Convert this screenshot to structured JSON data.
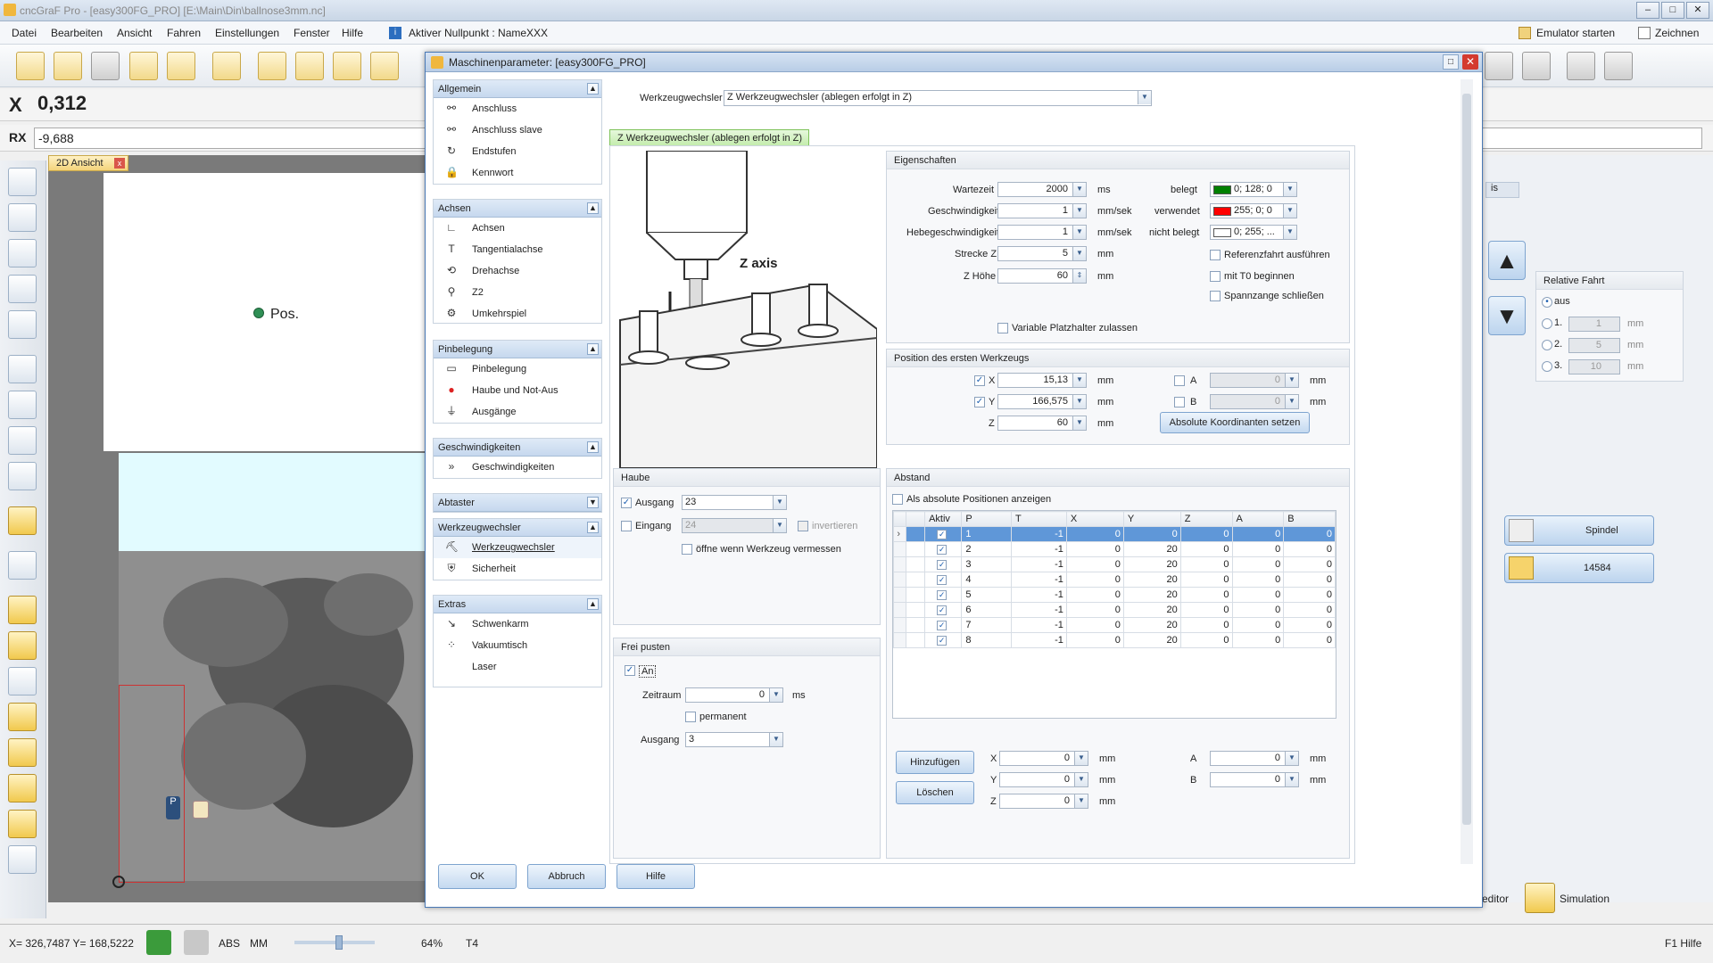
{
  "window": {
    "title": "cncGraF Pro - [easy300FG_PRO] [E:\\Main\\Din\\ballnose3mm.nc]"
  },
  "menu": [
    "Datei",
    "Bearbeiten",
    "Ansicht",
    "Fahren",
    "Einstellungen",
    "Fenster",
    "Hilfe"
  ],
  "nullpoint": "Aktiver Nullpunkt : NameXXX",
  "topright": {
    "emulator": "Emulator starten",
    "draw": "Zeichnen"
  },
  "coords": {
    "x_label": "X",
    "x_value": "0,312",
    "rx_label": "RX",
    "rx_value": "-9,688"
  },
  "view": {
    "tab": "2D Ansicht",
    "pos_label": "Pos."
  },
  "dialog": {
    "title": "Maschinenparameter: [easy300FG_PRO]",
    "changer_label": "Werkzeugwechsler",
    "changer_value": "Z Werkzeugwechsler (ablegen erfolgt in Z)",
    "tab": "Z Werkzeugwechsler (ablegen erfolgt in Z)",
    "diagram_label": "Z axis",
    "nav": [
      {
        "title": "Allgemein",
        "items": [
          "Anschluss",
          "Anschluss slave",
          "Endstufen",
          "Kennwort"
        ]
      },
      {
        "title": "Achsen",
        "items": [
          "Achsen",
          "Tangentialachse",
          "Drehachse",
          "Z2",
          "Umkehrspiel"
        ]
      },
      {
        "title": "Pinbelegung",
        "items": [
          "Pinbelegung",
          "Haube und Not-Aus",
          "Ausgänge"
        ]
      },
      {
        "title": "Geschwindigkeiten",
        "items": [
          "Geschwindigkeiten"
        ]
      },
      {
        "title": "Abtaster",
        "items": []
      },
      {
        "title": "Werkzeugwechsler",
        "items": [
          "Werkzeugwechsler",
          "Sicherheit"
        ]
      },
      {
        "title": "Extras",
        "items": [
          "Schwenkarm",
          "Vakuumtisch",
          "Laser"
        ]
      }
    ],
    "props": {
      "title": "Eigenschaften",
      "wartezeit": {
        "label": "Wartezeit",
        "value": "2000",
        "unit": "ms"
      },
      "geschw": {
        "label": "Geschwindigkeit",
        "value": "1",
        "unit": "mm/sek"
      },
      "hebe": {
        "label": "Hebegeschwindigkeit",
        "value": "1",
        "unit": "mm/sek"
      },
      "strecke": {
        "label": "Strecke Z",
        "value": "5",
        "unit": "mm"
      },
      "zhoehe": {
        "label": "Z Höhe",
        "value": "60",
        "unit": "mm"
      },
      "belegt": {
        "label": "belegt",
        "value": "0; 128; 0",
        "color": "#008000"
      },
      "verwendet": {
        "label": "verwendet",
        "value": "255; 0; 0",
        "color": "#ff0000"
      },
      "nicht": {
        "label": "nicht belegt",
        "value": "0; 255; ...",
        "color": "#ffffff"
      },
      "ref": "Referenzfahrt ausführen",
      "t0": "mit T0 beginnen",
      "spann": "Spannzange schließen",
      "variable": "Variable Platzhalter zulassen"
    },
    "firstpos": {
      "title": "Position des ersten Werkzeugs",
      "x": "15,13",
      "y": "166,575",
      "z": "60",
      "a": "0",
      "b": "0",
      "unit": "mm",
      "x_lbl": "X",
      "y_lbl": "Y",
      "z_lbl": "Z",
      "a_lbl": "A",
      "b_lbl": "B",
      "btn": "Absolute Koordinanten setzen"
    },
    "haube": {
      "title": "Haube",
      "ausgang": "Ausgang",
      "ausgang_val": "23",
      "eingang": "Eingang",
      "eingang_val": "24",
      "invert": "invertieren",
      "oeffne": "öffne wenn Werkzeug vermessen"
    },
    "frei": {
      "title": "Frei pusten",
      "an": "An",
      "zeitraum": "Zeitraum",
      "zeitraum_val": "0",
      "ms": "ms",
      "permanent": "permanent",
      "ausgang": "Ausgang",
      "ausgang_val": "3"
    },
    "abstand": {
      "title": "Abstand",
      "absolute": "Als absolute Positionen anzeigen",
      "headers": [
        "Aktiv",
        "P",
        "T",
        "X",
        "Y",
        "Z",
        "A",
        "B"
      ],
      "rows": [
        [
          "1",
          "-1",
          "0",
          "0",
          "0",
          "0",
          "0"
        ],
        [
          "2",
          "-1",
          "0",
          "20",
          "0",
          "0",
          "0"
        ],
        [
          "3",
          "-1",
          "0",
          "20",
          "0",
          "0",
          "0"
        ],
        [
          "4",
          "-1",
          "0",
          "20",
          "0",
          "0",
          "0"
        ],
        [
          "5",
          "-1",
          "0",
          "20",
          "0",
          "0",
          "0"
        ],
        [
          "6",
          "-1",
          "0",
          "20",
          "0",
          "0",
          "0"
        ],
        [
          "7",
          "-1",
          "0",
          "20",
          "0",
          "0",
          "0"
        ],
        [
          "8",
          "-1",
          "0",
          "20",
          "0",
          "0",
          "0"
        ]
      ],
      "add": "Hinzufügen",
      "del": "Löschen",
      "x": "0",
      "y": "0",
      "z": "0",
      "a": "0",
      "b": "0",
      "unit": "mm"
    },
    "buttons": {
      "ok": "OK",
      "cancel": "Abbruch",
      "help": "Hilfe"
    }
  },
  "rightpanel": {
    "relative": "Relative Fahrt",
    "aus": "aus",
    "r1": "1.",
    "r2": "2.",
    "r3": "3.",
    "v1": "1",
    "v2": "5",
    "v3": "10",
    "unit": "mm",
    "spindel": "Spindel",
    "speed": "14584",
    "zplus": "Z+",
    "zminus": "Z-",
    "tab_is": "is",
    "editor": "editor",
    "simulation": "Simulation"
  },
  "status": {
    "coords": "X= 326,7487 Y= 168,5222",
    "abs": "ABS",
    "mm": "MM",
    "zoom": "64%",
    "tool": "T4",
    "help": "F1 Hilfe"
  }
}
